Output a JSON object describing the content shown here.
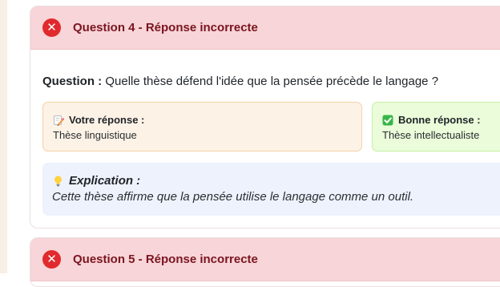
{
  "questions": [
    {
      "status_icon": "x-circle-icon",
      "title": "Question 4 - Réponse incorrecte",
      "question_label": "Question :",
      "question_text": "Quelle thèse défend l'idée que la pensée précède le langage ?",
      "your_answer": {
        "icon": "memo-pencil-icon",
        "label": "Votre réponse :",
        "value": "Thèse linguistique"
      },
      "correct_answer": {
        "icon": "check-mark-button-icon",
        "label": "Bonne réponse :",
        "value": "Thèse intellectualiste"
      },
      "explanation": {
        "icon": "light-bulb-icon",
        "label": "Explication :",
        "text": "Cette thèse affirme que la pensée utilise le langage comme un outil."
      }
    },
    {
      "status_icon": "x-circle-icon",
      "title": "Question 5 - Réponse incorrecte"
    }
  ],
  "status_glyph": "✕",
  "colors": {
    "incorrect_header_bg": "#f7d5d8",
    "incorrect_title": "#7a1520",
    "incorrect_badge": "#e12a2e",
    "your_answer_bg": "#fdf2e6",
    "correct_answer_bg": "#eafcd9",
    "explanation_bg": "#eef2fc"
  }
}
